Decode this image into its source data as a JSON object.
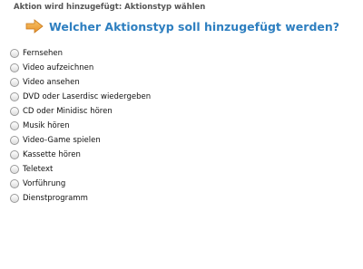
{
  "step": {
    "title": "Aktion wird hinzugefügt: Aktionstyp wählen"
  },
  "question": {
    "icon": "arrow-right-icon",
    "text": "Welcher Aktionstyp soll hinzugefügt werden?"
  },
  "colors": {
    "question_text": "#2e7fc0",
    "arrow_fill": "#f0a53a"
  },
  "options": [
    {
      "label": "Fernsehen",
      "selected": false
    },
    {
      "label": "Video aufzeichnen",
      "selected": false
    },
    {
      "label": "Video ansehen",
      "selected": false
    },
    {
      "label": "DVD oder Laserdisc wiedergeben",
      "selected": false
    },
    {
      "label": "CD oder Minidisc hören",
      "selected": false
    },
    {
      "label": "Musik hören",
      "selected": false
    },
    {
      "label": "Video-Game spielen",
      "selected": false
    },
    {
      "label": "Kassette hören",
      "selected": false
    },
    {
      "label": "Teletext",
      "selected": false
    },
    {
      "label": "Vorführung",
      "selected": false
    },
    {
      "label": "Dienstprogramm",
      "selected": false
    }
  ]
}
